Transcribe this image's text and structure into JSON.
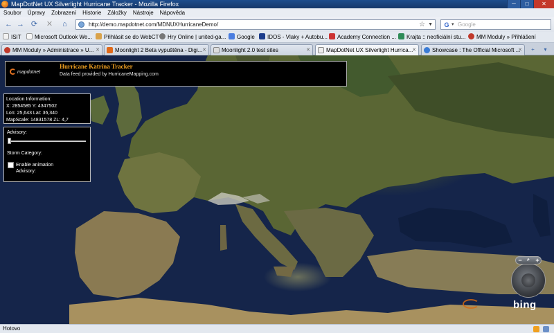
{
  "window": {
    "title": "MapDotNet UX Silverlight Hurricane Tracker - Mozilla Firefox",
    "buttons": {
      "minimize": "─",
      "maximize": "□",
      "close": "✕"
    }
  },
  "menu": [
    "Soubor",
    "Úpravy",
    "Zobrazení",
    "Historie",
    "Záložky",
    "Nástroje",
    "Nápověda"
  ],
  "nav": {
    "url": "http://demo.mapdotnet.com/MDNUXHurricaneDemo/",
    "search_placeholder": "Google",
    "back": "←",
    "forward": "→",
    "reload": "⟳",
    "stop": "✕",
    "home": "⌂"
  },
  "bookmarks": [
    {
      "label": "ISIT",
      "color": "#f2f2f2"
    },
    {
      "label": "Microsoft Outlook We...",
      "color": "#f7f7f7"
    },
    {
      "label": "Přihlásit se do WebCT",
      "color": "#d9a24a"
    },
    {
      "label": "Hry Online | united-ga...",
      "color": "#777777"
    },
    {
      "label": "Google",
      "color": "#4a7de0"
    },
    {
      "label": "IDOS - Vlaky + Autobu...",
      "color": "#1c3d8c"
    },
    {
      "label": "Academy Connection ...",
      "color": "#cc3333"
    },
    {
      "label": "Krajta :: neoficiální stu...",
      "color": "#2e8b57"
    },
    {
      "label": "MM Moduly » Přihlášení",
      "color": "#c0392b"
    }
  ],
  "tabs": [
    {
      "label": "MM Moduly » Administrace » U...",
      "color": "#c0392b",
      "active": false
    },
    {
      "label": "Moonlight 2 Beta vypuštěna - Digi...",
      "color": "#e06a1a",
      "active": false
    },
    {
      "label": "Moonlight 2.0 test sites",
      "color": "#dddddd",
      "active": false
    },
    {
      "label": "MapDotNet UX Silverlight Hurrica...",
      "color": "#eeeeee",
      "active": true
    },
    {
      "label": "Showcase : The Official Microsoft ...",
      "color": "#3a7bd5",
      "active": false
    }
  ],
  "app": {
    "logo_text": "mapdotnet",
    "title": "Hurricane Katrina Tracker",
    "subtitle": "Data feed provided by HurricaneMapping.com",
    "location": {
      "heading": "Location Information:",
      "xy": "X: 2854585  Y: 4347502",
      "lonlat": "Lon: 25,643  Lat: 36,340",
      "scale": "MapScale: 14831578  ZL: 4,7"
    },
    "advisory_label": "Advisory:",
    "advisory_value": 0,
    "storm_category_label": "Storm Category:",
    "enable_animation_label": "Enable animation",
    "advisory_label2": "Advisory:"
  },
  "map_controls": {
    "zoom_out": "−",
    "zoom_in": "+",
    "search": "🔍",
    "brand": "bing"
  },
  "status": {
    "text": "Hotovo"
  }
}
